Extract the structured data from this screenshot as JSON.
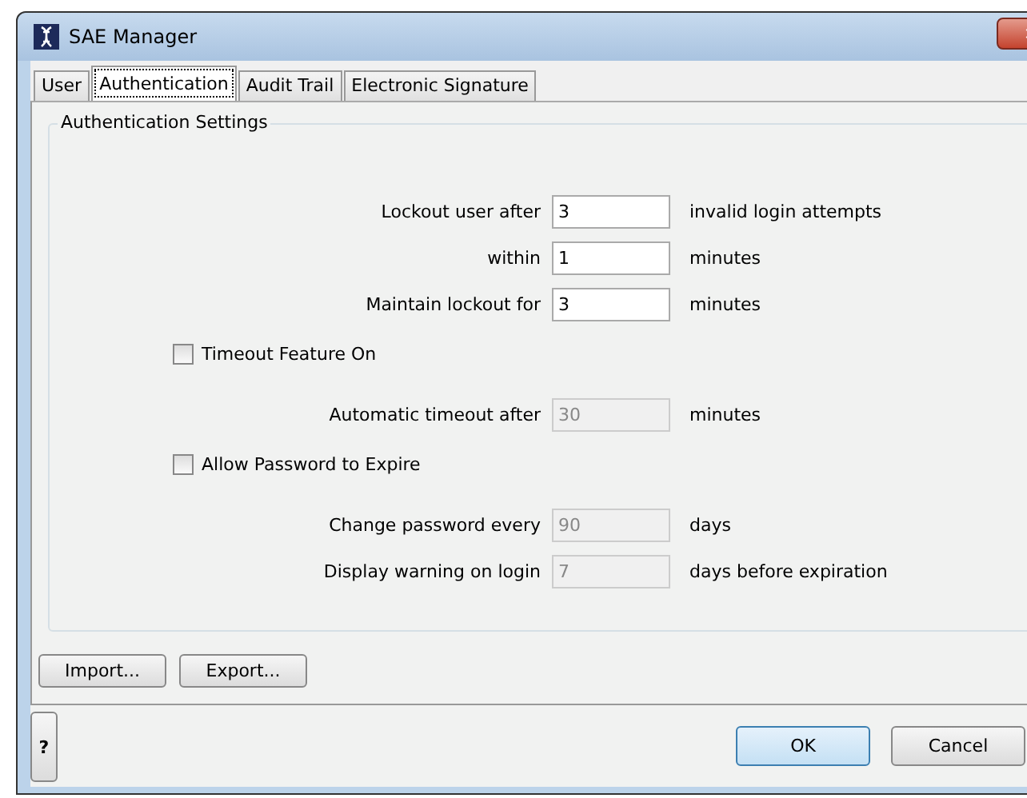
{
  "window": {
    "title": "SAE Manager"
  },
  "tabs": [
    {
      "label": "User",
      "selected": false
    },
    {
      "label": "Authentication",
      "selected": true
    },
    {
      "label": "Audit Trail",
      "selected": false
    },
    {
      "label": "Electronic Signature",
      "selected": false
    }
  ],
  "group": {
    "title": "Authentication Settings",
    "rows": [
      {
        "kind": "field",
        "label": "Lockout user after",
        "value": "3",
        "unit": "invalid login attempts",
        "disabled": false
      },
      {
        "kind": "field",
        "label": "within",
        "value": "1",
        "unit": "minutes",
        "disabled": false
      },
      {
        "kind": "field",
        "label": "Maintain lockout for",
        "value": "3",
        "unit": "minutes",
        "disabled": false
      },
      {
        "kind": "checkbox",
        "label": "Timeout Feature On",
        "checked": false
      },
      {
        "kind": "field",
        "label": "Automatic timeout after",
        "value": "30",
        "unit": "minutes",
        "disabled": true
      },
      {
        "kind": "checkbox",
        "label": "Allow Password to Expire",
        "checked": false
      },
      {
        "kind": "field",
        "label": "Change password every",
        "value": "90",
        "unit": "days",
        "disabled": true
      },
      {
        "kind": "field",
        "label": "Display warning on login",
        "value": "7",
        "unit": "days before expiration",
        "disabled": true
      }
    ]
  },
  "panel_buttons": [
    "Import...",
    "Export..."
  ],
  "help_button": "?",
  "dialog_buttons": [
    {
      "label": "OK",
      "default": true
    },
    {
      "label": "Cancel",
      "default": false
    }
  ]
}
